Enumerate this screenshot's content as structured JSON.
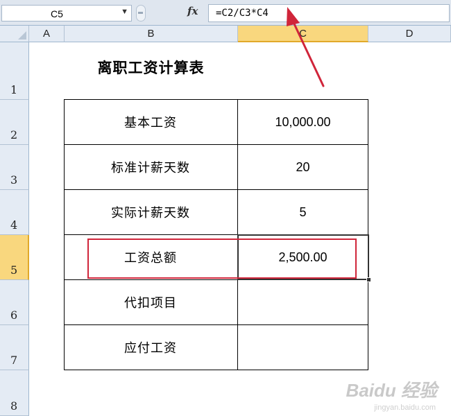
{
  "formula_bar": {
    "name_box": "C5",
    "fx_label": "fx",
    "formula": "=C2/C3*C4"
  },
  "columns": [
    "A",
    "B",
    "C",
    "D"
  ],
  "rows": [
    "1",
    "2",
    "3",
    "4",
    "5",
    "6",
    "7",
    "8"
  ],
  "selected": {
    "column": "C",
    "row": "5"
  },
  "sheet": {
    "title": "离职工资计算表",
    "table": [
      {
        "label": "基本工资",
        "value": "10,000.00"
      },
      {
        "label": "标准计薪天数",
        "value": "20"
      },
      {
        "label": "实际计薪天数",
        "value": "5"
      },
      {
        "label": "工资总额",
        "value": "2,500.00"
      },
      {
        "label": "代扣项目",
        "value": ""
      },
      {
        "label": "应付工资",
        "value": ""
      }
    ]
  },
  "watermark": {
    "brand": "Baidu 经验",
    "url": "jingyan.baidu.com"
  },
  "colors": {
    "highlight_box": "#d0253a",
    "arrow": "#d0253a",
    "selected_header": "#f9d77e"
  }
}
